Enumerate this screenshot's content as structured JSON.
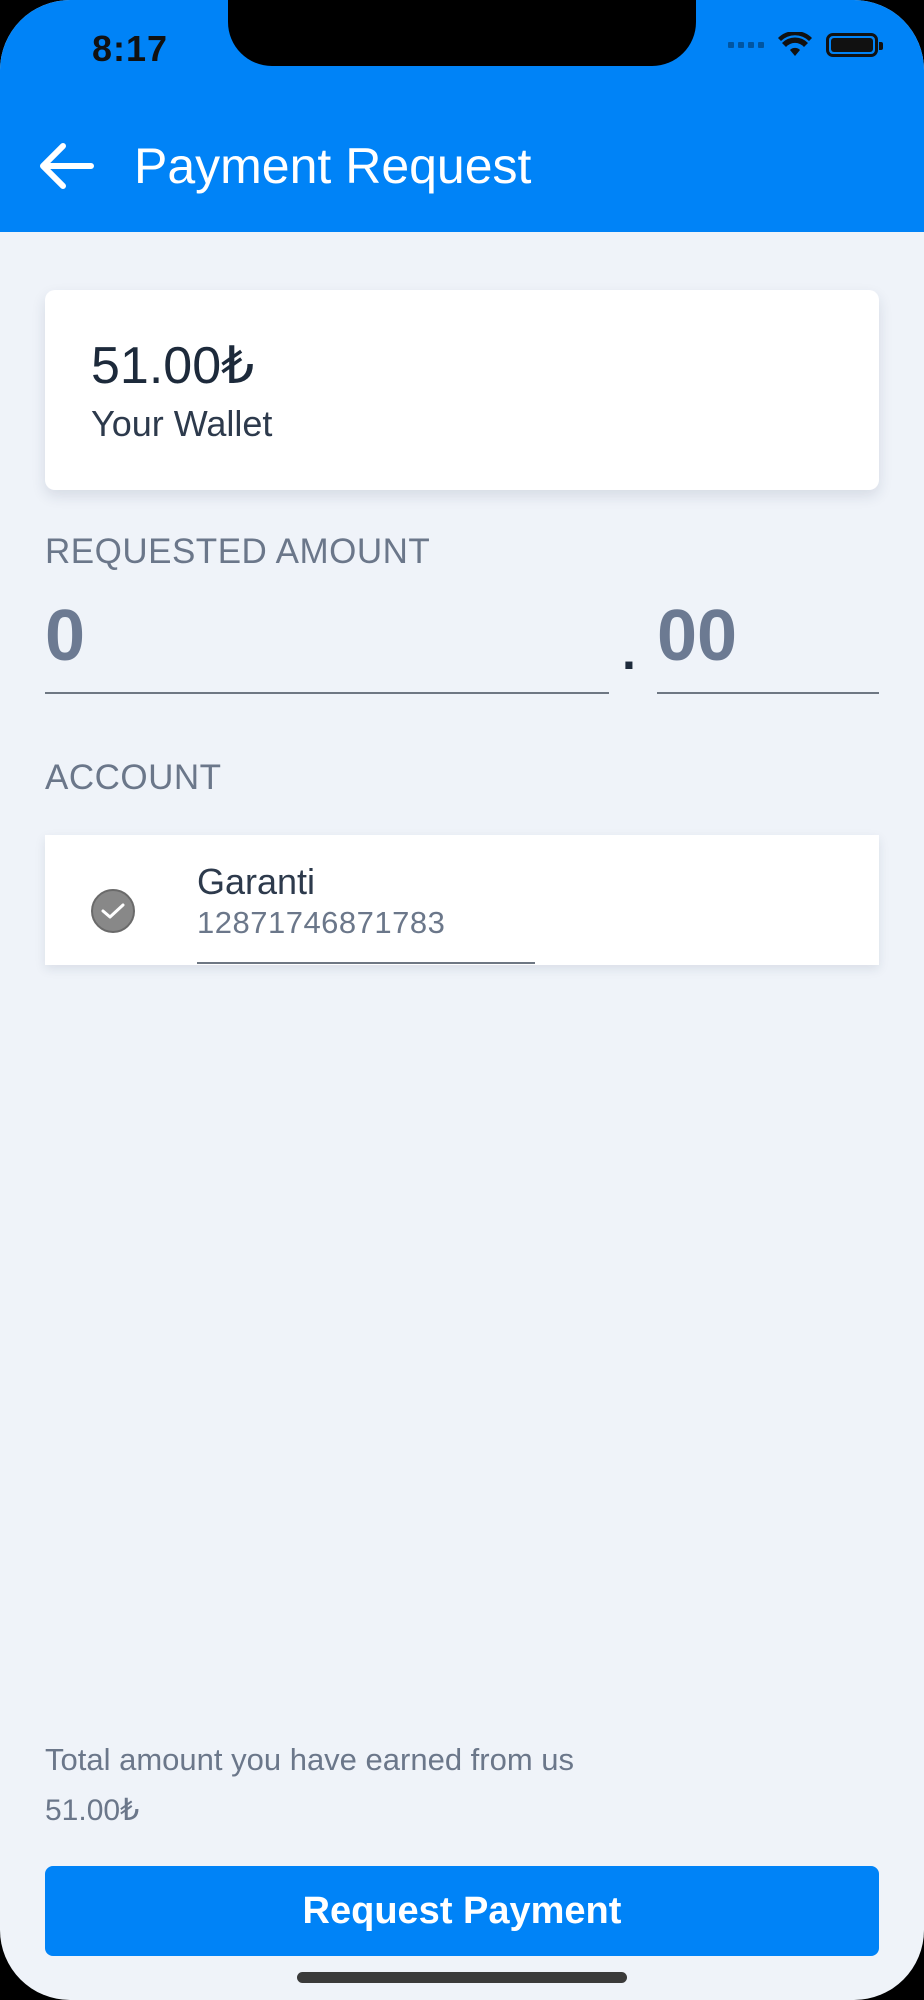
{
  "status_bar": {
    "time": "8:17",
    "icons": [
      "signal-icon",
      "wifi-icon",
      "battery-icon"
    ]
  },
  "header": {
    "title": "Payment Request",
    "back_icon": "arrow-left-icon"
  },
  "wallet": {
    "amount": "51.00₺",
    "label": "Your Wallet"
  },
  "requested_amount": {
    "label": "REQUESTED AMOUNT",
    "integer_value": "0",
    "separator": ".",
    "decimal_value": "00"
  },
  "account": {
    "label": "ACCOUNT",
    "selected": {
      "bank": "Garanti",
      "number": "12871746871783",
      "check_icon": "checkmark-circle-icon"
    }
  },
  "footer": {
    "earned_label": "Total amount you have earned from us",
    "earned_value": "51.00₺",
    "button_label": "Request Payment"
  },
  "colors": {
    "primary": "#0083f7",
    "background": "#eff3f9",
    "card": "#ffffff",
    "text_dark": "#1d2a3b",
    "text_muted": "#6b778a"
  }
}
